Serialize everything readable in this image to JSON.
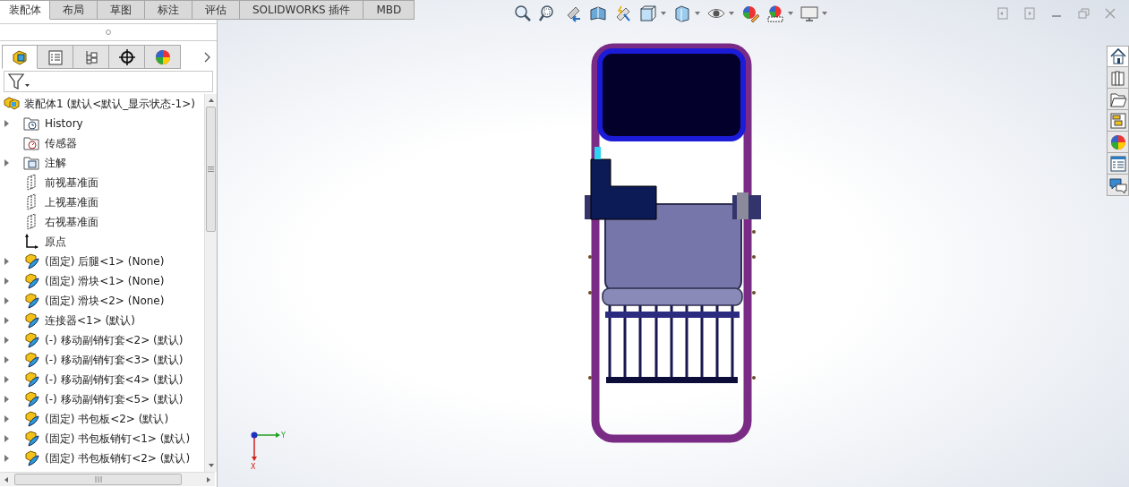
{
  "command_tabs": [
    {
      "label": "装配体",
      "selected": true
    },
    {
      "label": "布局",
      "selected": false
    },
    {
      "label": "草图",
      "selected": false
    },
    {
      "label": "标注",
      "selected": false
    },
    {
      "label": "评估",
      "selected": false
    },
    {
      "label": "SOLIDWORKS 插件",
      "selected": false
    },
    {
      "label": "MBD",
      "selected": false
    }
  ],
  "panel_tabs": [
    {
      "kind": "feature",
      "selected": true
    },
    {
      "kind": "property",
      "selected": false
    },
    {
      "kind": "configuration",
      "selected": false
    },
    {
      "kind": "dimxpert",
      "selected": false
    },
    {
      "kind": "display",
      "selected": false
    }
  ],
  "tree": {
    "label": "装配体1  (默认<默认_显示状态-1>)",
    "kind": "assembly",
    "children": [
      {
        "label": "History",
        "kind": "history",
        "collapsed": true
      },
      {
        "label": "传感器",
        "kind": "sensor",
        "collapsed": false
      },
      {
        "label": "注解",
        "kind": "annotation",
        "collapsed": true
      },
      {
        "label": "前视基准面",
        "kind": "plane",
        "collapsed": false
      },
      {
        "label": "上视基准面",
        "kind": "plane",
        "collapsed": false
      },
      {
        "label": "右视基准面",
        "kind": "plane",
        "collapsed": false
      },
      {
        "label": "原点",
        "kind": "origin",
        "collapsed": false
      },
      {
        "label": "(固定) 后腿<1> (None)",
        "kind": "part",
        "collapsed": true
      },
      {
        "label": "(固定) 滑块<1> (None)",
        "kind": "part",
        "collapsed": true
      },
      {
        "label": "(固定) 滑块<2> (None)",
        "kind": "part",
        "collapsed": true
      },
      {
        "label": "连接器<1> (默认)",
        "kind": "part",
        "collapsed": true
      },
      {
        "label": "(-) 移动副销钉套<2> (默认)",
        "kind": "part",
        "collapsed": true
      },
      {
        "label": "(-) 移动副销钉套<3> (默认)",
        "kind": "part",
        "collapsed": true
      },
      {
        "label": "(-) 移动副销钉套<4> (默认)",
        "kind": "part",
        "collapsed": true
      },
      {
        "label": "(-) 移动副销钉套<5> (默认)",
        "kind": "part",
        "collapsed": true
      },
      {
        "label": "(固定) 书包板<2> (默认)",
        "kind": "part",
        "collapsed": true
      },
      {
        "label": "(固定) 书包板销钉<1> (默认)",
        "kind": "part",
        "collapsed": true
      },
      {
        "label": "(固定) 书包板销钉<2> (默认)",
        "kind": "part",
        "collapsed": true
      }
    ]
  },
  "triad": {
    "y_label": "Y",
    "x_label": "X"
  },
  "task_pane": [
    {
      "kind": "home",
      "selected": true
    },
    {
      "kind": "library",
      "selected": false
    },
    {
      "kind": "folder",
      "selected": false
    },
    {
      "kind": "palette",
      "selected": false
    },
    {
      "kind": "appearance",
      "selected": false
    },
    {
      "kind": "properties",
      "selected": false
    },
    {
      "kind": "forum",
      "selected": false
    }
  ]
}
